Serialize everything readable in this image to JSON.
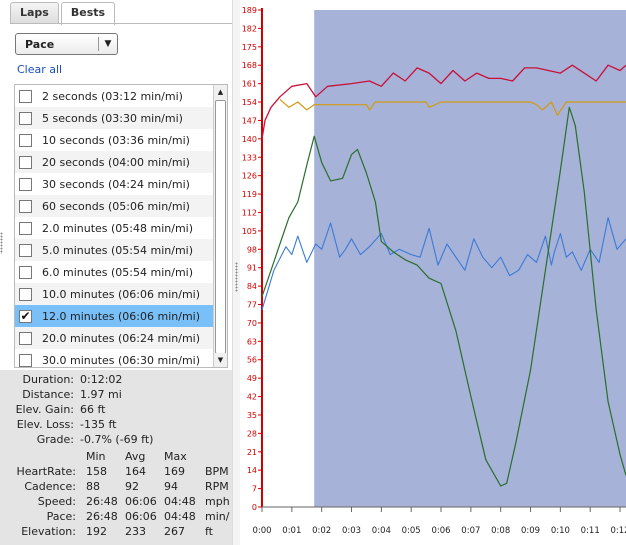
{
  "tabs": [
    {
      "label": "Laps",
      "active": false
    },
    {
      "label": "Bests",
      "active": true
    }
  ],
  "dropdown": {
    "value": "Pace"
  },
  "clear_all": "Clear all",
  "bests": [
    {
      "label": "2 seconds (03:12 min/mi)",
      "checked": false
    },
    {
      "label": "5 seconds (03:30 min/mi)",
      "checked": false
    },
    {
      "label": "10 seconds (03:36 min/mi)",
      "checked": false
    },
    {
      "label": "20 seconds (04:00 min/mi)",
      "checked": false
    },
    {
      "label": "30 seconds (04:24 min/mi)",
      "checked": false
    },
    {
      "label": "60 seconds (05:06 min/mi)",
      "checked": false
    },
    {
      "label": "2.0 minutes (05:48 min/mi)",
      "checked": false
    },
    {
      "label": "5.0 minutes (05:54 min/mi)",
      "checked": false
    },
    {
      "label": "6.0 minutes (05:54 min/mi)",
      "checked": false
    },
    {
      "label": "10.0 minutes (06:06 min/mi)",
      "checked": false
    },
    {
      "label": "12.0 minutes (06:06 min/mi)",
      "checked": true
    },
    {
      "label": "20.0 minutes (06:24 min/mi)",
      "checked": false
    },
    {
      "label": "30.0 minutes (06:30 min/mi)",
      "checked": false
    }
  ],
  "summary": [
    {
      "label": "Duration:",
      "value": "0:12:02"
    },
    {
      "label": "Distance:",
      "value": "1.97 mi"
    },
    {
      "label": "Elev. Gain:",
      "value": "66 ft"
    },
    {
      "label": "Elev. Loss:",
      "value": "-135 ft"
    },
    {
      "label": "Grade:",
      "value": "-0.7% (-69 ft)"
    }
  ],
  "metrics_header": {
    "min": "Min",
    "avg": "Avg",
    "max": "Max"
  },
  "metrics": [
    {
      "label": "HeartRate:",
      "min": "158",
      "avg": "164",
      "max": "169",
      "unit": "BPM"
    },
    {
      "label": "Cadence:",
      "min": "88",
      "avg": "92",
      "max": "94",
      "unit": "RPM"
    },
    {
      "label": "Speed:",
      "min": "26:48",
      "avg": "06:06",
      "max": "04:48",
      "unit": "mph"
    },
    {
      "label": "Pace:",
      "min": "26:48",
      "avg": "06:06",
      "max": "04:48",
      "unit": "min/"
    },
    {
      "label": "Elevation:",
      "min": "192",
      "avg": "233",
      "max": "267",
      "unit": "ft"
    }
  ],
  "colors": {
    "axis_red": "#d40000",
    "selection": "#a6b2d8",
    "heartrate": "#c8103a",
    "cadence": "#d39a10",
    "cadence_sel": "#9a8a5a",
    "speed": "#3b7ad6",
    "elevation": "#2a6e2a"
  },
  "chart_data": {
    "type": "line",
    "y_ticks": [
      "0",
      "7",
      "14",
      "21",
      "28",
      "35",
      "42",
      "49",
      "56",
      "63",
      "70",
      "77",
      "84",
      "91",
      "98",
      "105",
      "112",
      "119",
      "126",
      "133",
      "140",
      "147",
      "154",
      "161",
      "168",
      "175",
      "182",
      "189"
    ],
    "ylim": [
      0,
      189
    ],
    "x_ticks": [
      "0:00",
      "0:01",
      "0:02",
      "0:03",
      "0:04",
      "0:05",
      "0:06",
      "0:07",
      "0:08",
      "0:09",
      "0:10",
      "0:11",
      "0:12"
    ],
    "xlim": [
      0,
      12.2
    ],
    "selection": [
      1.75,
      12.2
    ],
    "series": [
      {
        "key": "heartrate",
        "x": [
          0,
          0.1,
          0.3,
          0.6,
          1.0,
          1.5,
          1.8,
          2.2,
          3.0,
          3.6,
          4.0,
          4.4,
          4.8,
          5.2,
          5.6,
          6.0,
          6.4,
          6.8,
          7.2,
          7.6,
          8.0,
          8.4,
          8.8,
          9.2,
          9.6,
          10.0,
          10.4,
          10.8,
          11.2,
          11.6,
          12.0,
          12.2
        ],
        "y": [
          140,
          147,
          152,
          156,
          160,
          161,
          156,
          160,
          161,
          162,
          160,
          165,
          162,
          167,
          165,
          161,
          166,
          162,
          165,
          163,
          163,
          162,
          167,
          167,
          166,
          165,
          168,
          165,
          162,
          168,
          166,
          168
        ]
      },
      {
        "key": "cadence",
        "x": [
          0.6,
          0.9,
          1.2,
          1.5,
          1.75,
          2.5,
          3.5,
          3.6,
          3.8,
          5.5,
          5.6,
          6.0,
          7.0,
          8.0,
          9.0,
          9.2,
          9.4,
          9.7,
          9.9,
          10.2,
          11.0,
          12.2
        ],
        "y": [
          155,
          152,
          154,
          151,
          153,
          153,
          153,
          151,
          154,
          154,
          152,
          154,
          154,
          154,
          154,
          153,
          151,
          154,
          149,
          154,
          154,
          154
        ]
      },
      {
        "key": "speed",
        "x": [
          0,
          0.4,
          0.8,
          1.0,
          1.2,
          1.5,
          1.8,
          2.0,
          2.3,
          2.6,
          2.8,
          3.0,
          3.3,
          3.6,
          4.0,
          4.3,
          4.6,
          5.0,
          5.3,
          5.6,
          5.9,
          6.2,
          6.5,
          6.8,
          7.1,
          7.4,
          7.7,
          8.0,
          8.3,
          8.6,
          8.9,
          9.2,
          9.5,
          9.7,
          9.8,
          10.0,
          10.2,
          10.4,
          10.7,
          11.0,
          11.3,
          11.6,
          11.9,
          12.2
        ],
        "y": [
          75,
          90,
          99,
          96,
          103,
          93,
          100,
          98,
          108,
          95,
          98,
          102,
          96,
          99,
          104,
          96,
          98,
          96,
          95,
          106,
          92,
          100,
          95,
          90,
          102,
          95,
          91,
          95,
          88,
          90,
          96,
          93,
          103,
          92,
          97,
          104,
          95,
          97,
          90,
          98,
          93,
          110,
          98,
          102
        ]
      },
      {
        "key": "elevation",
        "x": [
          0,
          0.3,
          0.6,
          0.9,
          1.2,
          1.5,
          1.75,
          2.0,
          2.3,
          2.7,
          3.0,
          3.2,
          3.5,
          3.8,
          4.0,
          4.4,
          4.8,
          5.2,
          5.6,
          6.0,
          6.5,
          7.0,
          7.5,
          8.0,
          8.2,
          8.5,
          9.0,
          9.5,
          10.0,
          10.3,
          10.5,
          10.8,
          11.2,
          11.6,
          12.0,
          12.2
        ],
        "y": [
          80,
          90,
          100,
          110,
          116,
          130,
          141,
          131,
          124,
          125,
          134,
          136,
          127,
          116,
          101,
          97,
          94,
          92,
          87,
          85,
          67,
          42,
          18,
          8,
          9,
          24,
          52,
          90,
          128,
          152,
          145,
          120,
          75,
          40,
          20,
          12
        ]
      }
    ]
  }
}
